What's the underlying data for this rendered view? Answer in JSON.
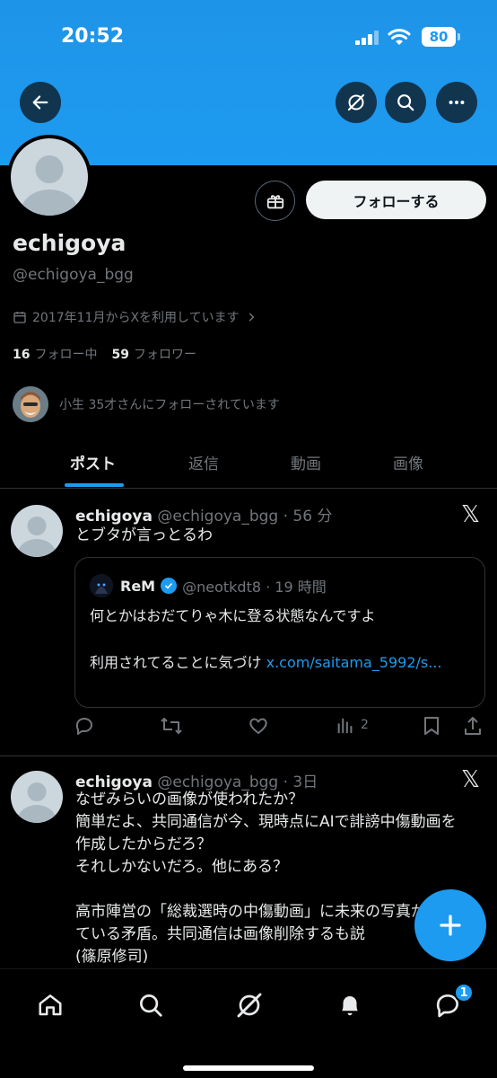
{
  "status_bar": {
    "time": "20:52",
    "battery": "80"
  },
  "header": {
    "back_label": "back",
    "colors": {
      "banner": "#1d9bf0",
      "accent": "#1d9bf0"
    }
  },
  "profile": {
    "name": "echigoya",
    "handle": "@echigoya_bgg",
    "joined": "2017年11月からXを利用しています",
    "following_count": "16",
    "following_label": "フォロー中",
    "followers_count": "59",
    "followers_label": "フォロワー",
    "followed_by": "小生 35才さんにフォローされています",
    "follow_button": "フォローする"
  },
  "tabs": [
    {
      "label": "ポスト",
      "active": true
    },
    {
      "label": "返信",
      "active": false
    },
    {
      "label": "動画",
      "active": false
    },
    {
      "label": "画像",
      "active": false
    }
  ],
  "posts": [
    {
      "name": "echigoya",
      "meta": "@echigoya_bgg · 56 分",
      "text": "とブタが言っとるわ",
      "quote": {
        "name": "ReM",
        "meta": "@neotkdt8 · 19 時間",
        "text1": "何とかはおだてりゃ木に登る状態なんですよ",
        "text2": "利用されてることに気づけ ",
        "link": "x.com/saitama_5992/s..."
      },
      "views": "2"
    },
    {
      "name": "echigoya",
      "meta": "@echigoya_bgg · 3日",
      "text": "なぜみらいの画像が使われたか？\n簡単だよ、共同通信が今、現時点にAIで誹謗中傷動画を作成したからだろ？\nそれしかないだろ。他にある？\n\n高市陣営の「総裁選時の中傷動画」に未来の写真がわれている矛盾。共同通信は画像削除するも説\n(篠原修司)"
    }
  ],
  "bottom_nav": {
    "messages_badge": "1"
  }
}
